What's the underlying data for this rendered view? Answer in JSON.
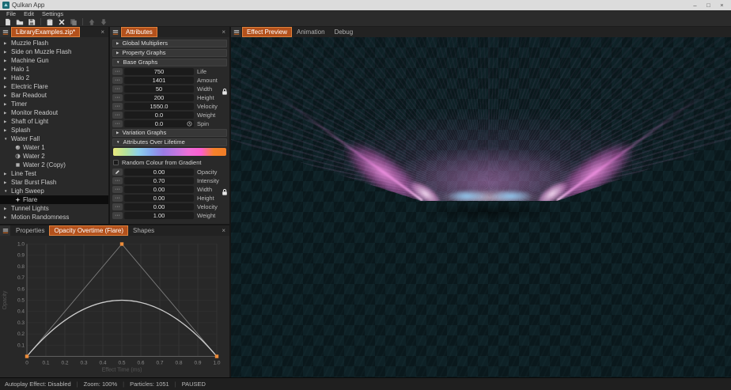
{
  "window": {
    "title": "Qulkan App",
    "controls": [
      "minimize",
      "maximize",
      "close"
    ]
  },
  "glyphs": {
    "minimize": "–",
    "maximize": "□",
    "close": "×"
  },
  "menu_bar": {
    "items": [
      "File",
      "Edit",
      "Settings"
    ]
  },
  "toolbar": {
    "groups": [
      [
        "new-file",
        "open-folder",
        "save"
      ],
      [
        "paste",
        "delete-item",
        "copy"
      ],
      [
        "move-up",
        "move-down"
      ]
    ],
    "disabled": [
      "copy",
      "move-up",
      "move-down"
    ]
  },
  "library_panel": {
    "tab_label": "LibraryExamples.zip*",
    "items": [
      {
        "label": "Muzzle Flash",
        "arrow": "collapsed",
        "level": 0
      },
      {
        "label": "Side on Muzzle Flash",
        "arrow": "collapsed",
        "level": 0
      },
      {
        "label": "Machine Gun",
        "arrow": "collapsed",
        "level": 0
      },
      {
        "label": "Halo 1",
        "arrow": "collapsed",
        "level": 0
      },
      {
        "label": "Halo 2",
        "arrow": "collapsed",
        "level": 0
      },
      {
        "label": "Electric Flare",
        "arrow": "collapsed",
        "level": 0
      },
      {
        "label": "Bar Readout",
        "arrow": "collapsed",
        "level": 0
      },
      {
        "label": "Timer",
        "arrow": "collapsed",
        "level": 0
      },
      {
        "label": "Monitor Readout",
        "arrow": "collapsed",
        "level": 0
      },
      {
        "label": "Shaft of Light",
        "arrow": "collapsed",
        "level": 0
      },
      {
        "label": "Splash",
        "arrow": "collapsed",
        "level": 0
      },
      {
        "label": "Water Fall",
        "arrow": "expanded",
        "level": 0
      },
      {
        "label": "Water 1",
        "icon": "sphere",
        "level": 1
      },
      {
        "label": "Water 2",
        "icon": "half-circle",
        "level": 1
      },
      {
        "label": "Water 2 (Copy)",
        "icon": "square",
        "level": 1
      },
      {
        "label": "Line Test",
        "arrow": "collapsed",
        "level": 0
      },
      {
        "label": "Star Burst Flash",
        "arrow": "collapsed",
        "level": 0
      },
      {
        "label": "Ligh Sweep",
        "arrow": "expanded",
        "level": 0
      },
      {
        "label": "Flare",
        "icon": "flare",
        "level": 1,
        "selected": true
      },
      {
        "label": "Tunnel Lights",
        "arrow": "collapsed",
        "level": 0
      },
      {
        "label": "Motion Randomness",
        "arrow": "collapsed",
        "level": 0
      }
    ]
  },
  "attributes_panel": {
    "tab_label": "Attributes",
    "sections": [
      {
        "label": "Global Multipliers",
        "state": "collapsed"
      },
      {
        "label": "Property Graphs",
        "state": "collapsed"
      },
      {
        "label": "Base Graphs",
        "state": "expanded"
      },
      {
        "label": "Variation Graphs",
        "state": "collapsed"
      },
      {
        "label": "Attributes Over Lifetime",
        "state": "expanded"
      }
    ],
    "base_rows": [
      {
        "value": "750",
        "label": "Life",
        "button": "dots"
      },
      {
        "value": "1401",
        "label": "Amount",
        "button": "dots"
      },
      {
        "value": "50",
        "label": "Width",
        "button": "dots",
        "lock": true
      },
      {
        "value": "200",
        "label": "Height",
        "button": "dots"
      },
      {
        "value": "1550.0",
        "label": "Velocity",
        "button": "dots"
      },
      {
        "value": "0.0",
        "label": "Weight",
        "button": "dots"
      },
      {
        "value": "0.0",
        "label": "Spin",
        "button": "dots",
        "clock": true
      }
    ],
    "gradient_colors": [
      "#e9e87c",
      "#b5e39b",
      "#8fd2ea",
      "#86a7ee",
      "#9b7ce4",
      "#c178e2",
      "#ee6fd8",
      "#fb5fcf",
      "#f5822b",
      "#ef7d27"
    ],
    "checkbox_label": "Random Colour from Gradient",
    "checkbox_checked": false,
    "lifetime_rows": [
      {
        "value": "0.00",
        "label": "Opacity",
        "button": "pencil"
      },
      {
        "value": "0.70",
        "label": "Intensity",
        "button": "dots"
      },
      {
        "value": "0.00",
        "label": "Width",
        "button": "dots",
        "lock": true
      },
      {
        "value": "0.00",
        "label": "Height",
        "button": "dots"
      },
      {
        "value": "0.00",
        "label": "Velocity",
        "button": "dots"
      },
      {
        "value": "1.00",
        "label": "Weight",
        "button": "dots"
      }
    ]
  },
  "preview_panel": {
    "tabs": [
      {
        "label": "Effect Preview",
        "active": true
      },
      {
        "label": "Animation",
        "active": false
      },
      {
        "label": "Debug",
        "active": false
      }
    ],
    "effect": {
      "background_checker": [
        "#0e2126",
        "#0a181c"
      ],
      "ray_color": "#f2a0ee",
      "glow_colors": [
        "#ff96ee",
        "#ffe4fc",
        "#91d4ff"
      ]
    }
  },
  "graph_panel": {
    "tabs": [
      {
        "label": "Properties",
        "active": false
      },
      {
        "label": "Opacity Overtime (Flare)",
        "active": true
      },
      {
        "label": "Shapes",
        "active": false
      }
    ],
    "chart_data": {
      "type": "line",
      "title": "Opacity Overtime (Flare)",
      "xlabel": "Effect Time (ms)",
      "ylabel": "Opacity",
      "xlim": [
        0,
        1.0
      ],
      "ylim": [
        0,
        1.0
      ],
      "x_ticks": [
        "0",
        "0.1",
        "0.2",
        "0.3",
        "0.4",
        "0.5",
        "0.6",
        "0.7",
        "0.8",
        "0.9",
        "1.0"
      ],
      "y_ticks": [
        "1.0",
        "0.9",
        "0.8",
        "0.7",
        "0.6",
        "0.5",
        "0.4",
        "0.3",
        "0.2",
        "0.1"
      ],
      "grid": true,
      "curve": {
        "kind": "quadratic_bezier",
        "start": [
          0,
          0
        ],
        "control": [
          0.5,
          1.0
        ],
        "end": [
          1.0,
          0
        ],
        "peak_value": 0.5
      },
      "control_points": [
        [
          0,
          0
        ],
        [
          0.5,
          1.0
        ],
        [
          1.0,
          0
        ]
      ],
      "point_color": "#ec8c3a",
      "line_color": "#cfcfcf",
      "handle_color": "#7d7d7d"
    }
  },
  "status_bar": {
    "items": [
      "Autoplay Effect: Disabled",
      "Zoom: 100%",
      "Particles: 1051",
      "PAUSED"
    ]
  },
  "colors": {
    "accent": "#b3511c",
    "accent_border": "#e0823c",
    "titlebar": "#dcdcdc",
    "panel_bg": "#292929"
  }
}
